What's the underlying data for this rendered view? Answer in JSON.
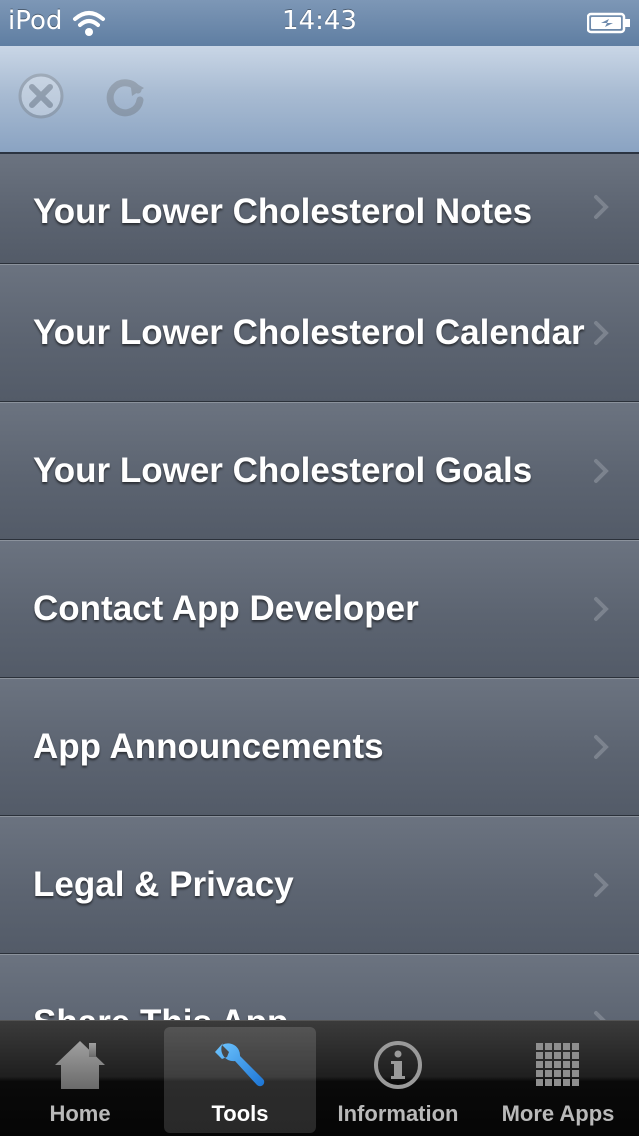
{
  "status_bar": {
    "carrier": "iPod",
    "time": "14:43",
    "wifi_icon": "wifi-icon",
    "battery_icon": "battery-charging-icon"
  },
  "toolbar": {
    "buttons": [
      {
        "icon": "close-icon",
        "enabled": false
      },
      {
        "icon": "refresh-icon",
        "enabled": false
      }
    ]
  },
  "menu": {
    "items": [
      {
        "label": "Your Lower Cholesterol Notes"
      },
      {
        "label": "Your Lower Cholesterol Calendar"
      },
      {
        "label": "Your Lower Cholesterol Goals"
      },
      {
        "label": "Contact App Developer"
      },
      {
        "label": "App Announcements"
      },
      {
        "label": "Legal & Privacy"
      },
      {
        "label": "Share This App"
      }
    ]
  },
  "tab_bar": {
    "selected": "Tools",
    "tabs": [
      {
        "label": "Home",
        "icon": "home-icon"
      },
      {
        "label": "Tools",
        "icon": "wrench-icon"
      },
      {
        "label": "Information",
        "icon": "info-icon"
      },
      {
        "label": "More Apps",
        "icon": "grid-icon"
      }
    ]
  },
  "colors": {
    "status_bar": "#6e8aad",
    "toolbar": "#a8bbd2",
    "list_item": "#5f6774",
    "tab_bar": "#1a1a1a",
    "label_text": "#ffffff"
  }
}
